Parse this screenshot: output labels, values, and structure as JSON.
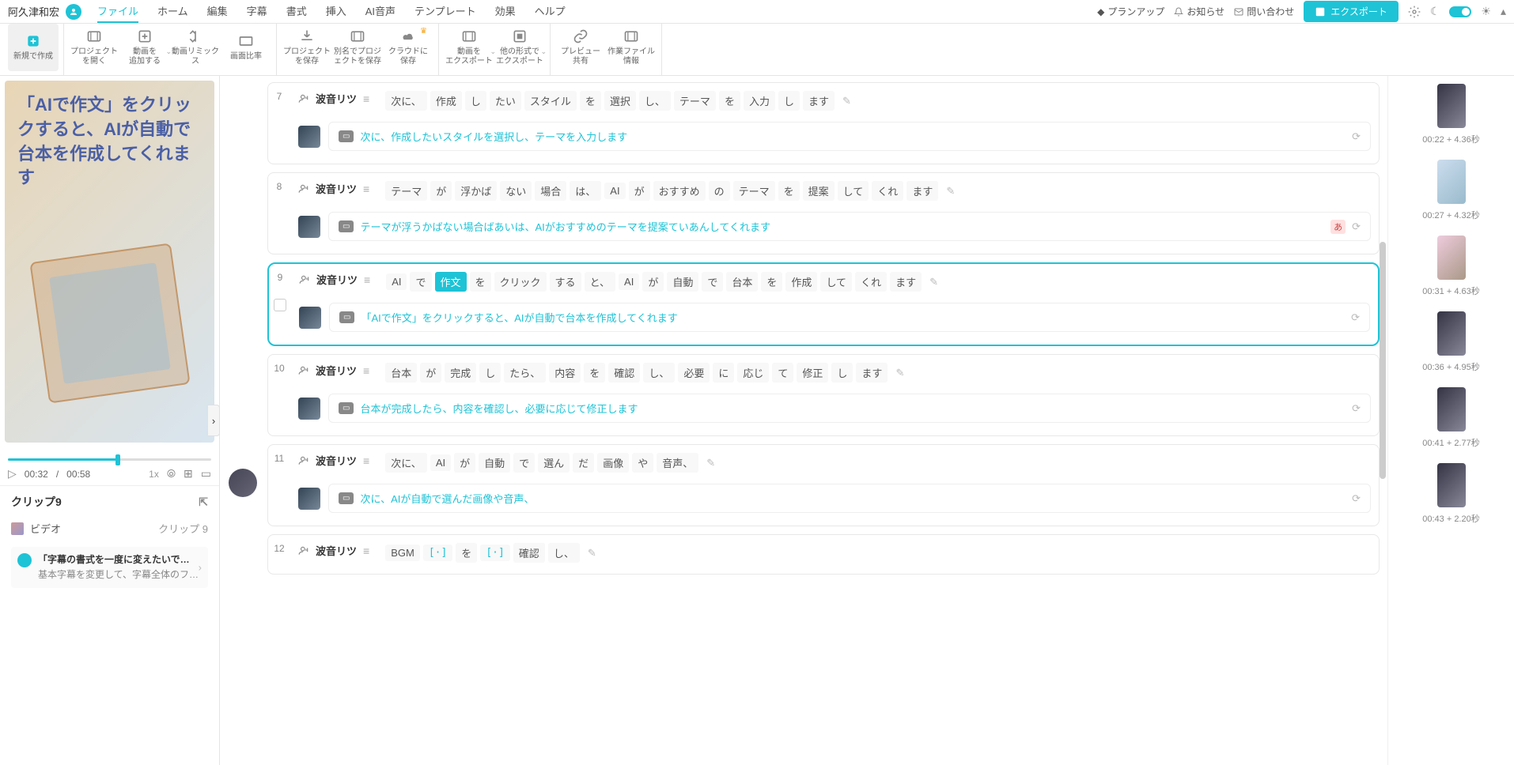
{
  "user": {
    "name": "阿久津和宏"
  },
  "menu": [
    "ファイル",
    "ホーム",
    "編集",
    "字幕",
    "書式",
    "挿入",
    "AI音声",
    "テンプレート",
    "効果",
    "ヘルプ"
  ],
  "menu_active": 0,
  "topbar_right": {
    "plan": "プランアップ",
    "notice": "お知らせ",
    "contact": "問い合わせ",
    "export": "エクスポート"
  },
  "toolbar": [
    {
      "label": "新規で作成",
      "icon": "plus",
      "active": true
    },
    {
      "label": "プロジェクト\nを開く",
      "icon": "film"
    },
    {
      "label": "動画を\n追加する",
      "icon": "plus-sq",
      "chevron": true
    },
    {
      "label": "動画リミックス",
      "icon": "remix"
    },
    {
      "label": "画面比率",
      "icon": "aspect"
    },
    {
      "label": "プロジェクト\nを保存",
      "icon": "download"
    },
    {
      "label": "別名でプロジ\nェクトを保存",
      "icon": "film"
    },
    {
      "label": "クラウドに\n保存",
      "icon": "cloud",
      "crown": true
    },
    {
      "label": "動画を\nエクスポート",
      "icon": "film",
      "chevron": true
    },
    {
      "label": "他の形式で\nエクスポート",
      "icon": "square",
      "chevron": true
    },
    {
      "label": "プレビュー\n共有",
      "icon": "link"
    },
    {
      "label": "作業ファイル\n情報",
      "icon": "film"
    }
  ],
  "preview_text": "「AIで作文」をクリックすると、AIが自動で台本を作成してくれます",
  "playback": {
    "current": "00:32",
    "total": "00:58",
    "speed": "1x"
  },
  "clip_info": {
    "title": "クリップ9",
    "type": "ビデオ",
    "clip_label": "クリップ 9",
    "note_title": "「字幕の書式を一度に変えたいで…",
    "note_sub": "基本字幕を変更して、字幕全体のフ…"
  },
  "voice_name": "波音リツ",
  "clips": [
    {
      "num": "7",
      "tokens": [
        "次に、",
        "作成",
        "し",
        "たい",
        "スタイル",
        "を",
        "選択",
        "し、",
        "テーマ",
        "を",
        "入力",
        "し",
        "ます"
      ],
      "result": "次に、作成したいスタイルを選択し、テーマを入力します"
    },
    {
      "num": "8",
      "tokens": [
        "テーマ",
        "が",
        "浮かば",
        "ない",
        "場合",
        "は、",
        "AI",
        "が",
        "おすすめ",
        "の",
        "テーマ",
        "を",
        "提案",
        "して",
        "くれ",
        "ます"
      ],
      "result": "テーマが浮うかばない場合ばあいは、AIがおすすめのテーマを提案ていあんしてくれます",
      "lang": "あ",
      "thumb_alt": "alt1"
    },
    {
      "num": "9",
      "selected": true,
      "tokens": [
        "AI",
        "で",
        "作文",
        "を",
        "クリック",
        "する",
        "と、",
        "AI",
        "が",
        "自動",
        "で",
        "台本",
        "を",
        "作成",
        "して",
        "くれ",
        "ます"
      ],
      "hl_index": 2,
      "result": "「AIで作文」をクリックすると、AIが自動で台本を作成してくれます",
      "thumb_alt": "alt2"
    },
    {
      "num": "10",
      "tokens": [
        "台本",
        "が",
        "完成",
        "し",
        "たら、",
        "内容",
        "を",
        "確認",
        "し、",
        "必要",
        "に",
        "応じ",
        "て",
        "修正",
        "し",
        "ます"
      ],
      "result": "台本が完成したら、内容を確認し、必要に応じて修正します"
    },
    {
      "num": "11",
      "tokens": [
        "次に、",
        "AI",
        "が",
        "自動",
        "で",
        "選ん",
        "だ",
        "画像",
        "や",
        "音声、"
      ],
      "result": "次に、AIが自動で選んだ画像や音声、",
      "avatar": true
    },
    {
      "num": "12",
      "tokens_special": [
        "BGM",
        "[·]",
        "を",
        "[·]",
        "確認",
        "し、"
      ],
      "no_result": true
    }
  ],
  "thumbnails": [
    {
      "label": "00:22 + 4.36秒",
      "alt": ""
    },
    {
      "label": "00:27 + 4.32秒",
      "alt": "alt1"
    },
    {
      "label": "00:31 + 4.63秒",
      "alt": "alt2"
    },
    {
      "label": "00:36 + 4.95秒",
      "alt": ""
    },
    {
      "label": "00:41 + 2.77秒",
      "alt": ""
    },
    {
      "label": "00:43 + 2.20秒",
      "alt": ""
    }
  ]
}
